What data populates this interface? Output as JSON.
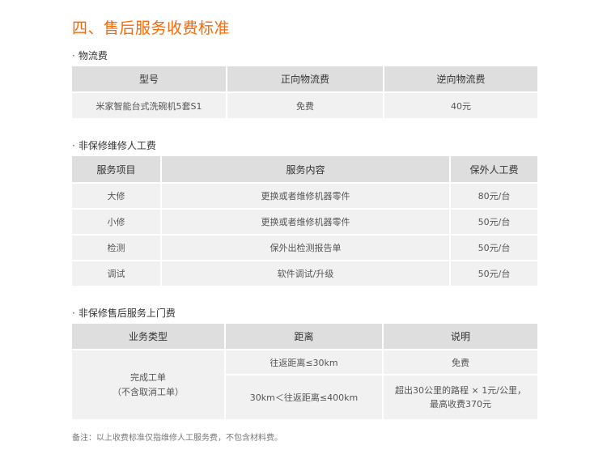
{
  "title": "四、售后服务收费标准",
  "sections": {
    "logistics": {
      "label": "物流费",
      "headers": [
        "型号",
        "正向物流费",
        "逆向物流费"
      ],
      "row": [
        "米家智能台式洗碗机5套S1",
        "免费",
        "40元"
      ]
    },
    "labor": {
      "label": "非保修维修人工费",
      "headers": [
        "服务项目",
        "服务内容",
        "保外人工费"
      ],
      "rows": [
        [
          "大修",
          "更换或者维修机器零件",
          "80元/台"
        ],
        [
          "小修",
          "更换或者维修机器零件",
          "50元/台"
        ],
        [
          "检测",
          "保外出检测报告单",
          "50元/台"
        ],
        [
          "调试",
          "软件调试/升级",
          "50元/台"
        ]
      ]
    },
    "visit": {
      "label": "非保修售后服务上门费",
      "headers": [
        "业务类型",
        "距离",
        "说明"
      ],
      "type_line1": "完成工单",
      "type_line2": "（不含取消工单）",
      "rows": [
        {
          "distance": "往返距离≤30km",
          "desc_line1": "免费",
          "desc_line2": ""
        },
        {
          "distance": "30km＜往返距离≤400km",
          "desc_line1": "超出30公里的路程 × 1元/公里，",
          "desc_line2": "最高收费370元"
        }
      ]
    }
  },
  "note": "备注：以上收费标准仅指维修人工服务费，不包含材料费。"
}
